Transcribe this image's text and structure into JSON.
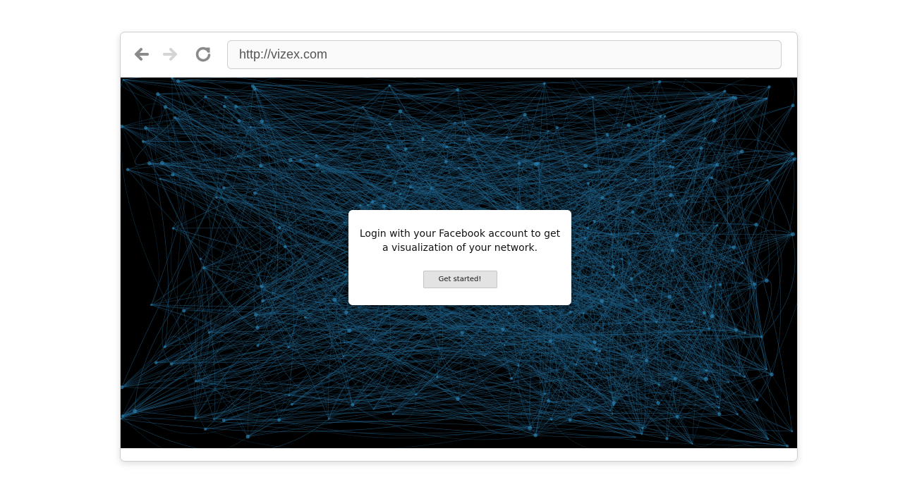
{
  "browser": {
    "url": "http://vizex.com",
    "nav_icons": [
      "back-arrow-icon",
      "forward-arrow-icon",
      "reload-icon"
    ]
  },
  "login_dialog": {
    "message": "Login with your Facebook account to get a visualization of your network.",
    "button_label": "Get started!"
  },
  "colors": {
    "network_background": "#000000",
    "network_edge": "#1f5f86",
    "network_node": "#2a7fae",
    "icon_back": "#8a8a8a",
    "icon_forward": "#d5d5d5",
    "icon_reload": "#8a8a8a"
  }
}
